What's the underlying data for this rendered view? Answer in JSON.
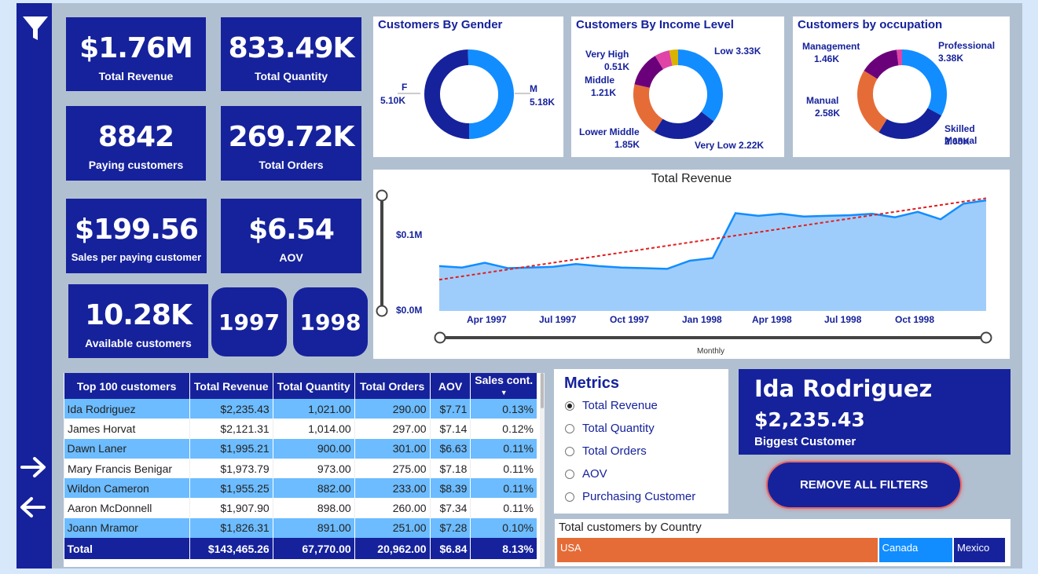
{
  "kpis": {
    "total_revenue": {
      "value": "$1.76M",
      "label": "Total Revenue"
    },
    "total_quantity": {
      "value": "833.49K",
      "label": "Total Quantity"
    },
    "paying_customers": {
      "value": "8842",
      "label": "Paying customers"
    },
    "total_orders": {
      "value": "269.72K",
      "label": "Total Orders"
    },
    "sales_per_paying": {
      "value": "$199.56",
      "label": "Sales per paying customer"
    },
    "aov": {
      "value": "$6.54",
      "label": "AOV"
    },
    "available_customers": {
      "value": "10.28K",
      "label": "Available customers"
    }
  },
  "years": [
    "1997",
    "1998"
  ],
  "gender_chart": {
    "title": "Customers By Gender",
    "labels": [
      {
        "name": "F",
        "value": "5.10K"
      },
      {
        "name": "M",
        "value": "5.18K"
      }
    ]
  },
  "income_chart": {
    "title": "Customers By Income Level",
    "labels": [
      {
        "name": "Low",
        "value": "3.33K"
      },
      {
        "name": "Very Low",
        "value": "2.22K"
      },
      {
        "name": "Lower Middle",
        "value": "1.85K"
      },
      {
        "name": "Middle",
        "value": "1.21K"
      },
      {
        "name": "Very High",
        "value": "0.51K"
      }
    ]
  },
  "occupation_chart": {
    "title": "Customers by occupation",
    "labels": [
      {
        "name": "Professional",
        "value": "3.38K"
      },
      {
        "name": "Skilled Manual",
        "value": "2.65K"
      },
      {
        "name": "Manual",
        "value": "2.58K"
      },
      {
        "name": "Management",
        "value": "1.46K"
      }
    ]
  },
  "revenue_chart": {
    "title": "Total Revenue",
    "xlabel": "Monthly",
    "y_ticks": [
      "$0.0M",
      "$0.1M"
    ],
    "x_ticks": [
      "Apr 1997",
      "Jul 1997",
      "Oct 1997",
      "Jan 1998",
      "Apr 1998",
      "Jul 1998",
      "Oct 1998"
    ]
  },
  "chart_data": [
    {
      "type": "pie",
      "title": "Customers By Gender",
      "categories": [
        "F",
        "M"
      ],
      "values": [
        5.1,
        5.18
      ],
      "unit": "K",
      "colors": [
        "#16229b",
        "#118dff"
      ]
    },
    {
      "type": "pie",
      "title": "Customers By Income Level",
      "categories": [
        "Low",
        "Very Low",
        "Lower Middle",
        "Middle",
        "Very High",
        "High"
      ],
      "values": [
        3.33,
        2.22,
        1.85,
        1.21,
        0.51,
        0.3
      ],
      "unit": "K",
      "colors": [
        "#118dff",
        "#16229b",
        "#e66c37",
        "#6b007b",
        "#e044a7",
        "#d9b300"
      ]
    },
    {
      "type": "pie",
      "title": "Customers by occupation",
      "categories": [
        "Professional",
        "Skilled Manual",
        "Manual",
        "Management",
        "Clerical"
      ],
      "values": [
        3.38,
        2.65,
        2.58,
        1.46,
        0.2
      ],
      "unit": "K",
      "colors": [
        "#118dff",
        "#16229b",
        "#e66c37",
        "#6b007b",
        "#e044a7"
      ]
    },
    {
      "type": "area",
      "title": "Total Revenue",
      "xlabel": "Monthly",
      "ylabel": "",
      "x": [
        "Jan 1997",
        "Feb 1997",
        "Mar 1997",
        "Apr 1997",
        "May 1997",
        "Jun 1997",
        "Jul 1997",
        "Aug 1997",
        "Sep 1997",
        "Oct 1997",
        "Nov 1997",
        "Dec 1997",
        "Jan 1998",
        "Feb 1998",
        "Mar 1998",
        "Apr 1998",
        "May 1998",
        "Jun 1998",
        "Jul 1998",
        "Aug 1998",
        "Sep 1998",
        "Oct 1998",
        "Nov 1998",
        "Dec 1998"
      ],
      "values": [
        0.066,
        0.064,
        0.071,
        0.063,
        0.064,
        0.065,
        0.069,
        0.066,
        0.064,
        0.063,
        0.062,
        0.074,
        0.078,
        0.144,
        0.14,
        0.143,
        0.139,
        0.14,
        0.141,
        0.143,
        0.138,
        0.146,
        0.135,
        0.158,
        0.163
      ],
      "trend": [
        0.046,
        0.166
      ],
      "ylim": [
        0,
        0.17
      ],
      "colors": {
        "area": "#9fcdfb",
        "line": "#118dff",
        "trend": "#e01e1e"
      }
    },
    {
      "type": "bar",
      "title": "Total customers by Country",
      "categories": [
        "USA",
        "Canada",
        "Mexico"
      ],
      "values": [
        7.95,
        1.85,
        1.3
      ],
      "colors": [
        "#e66c37",
        "#118dff",
        "#16229b"
      ]
    }
  ],
  "table": {
    "headers": [
      "Top 100 customers",
      "Total Revenue",
      "Total Quantity",
      "Total Orders",
      "AOV",
      "Sales cont."
    ],
    "rows": [
      [
        "Ida Rodriguez",
        "$2,235.43",
        "1,021.00",
        "290.00",
        "$7.71",
        "0.13%"
      ],
      [
        "James Horvat",
        "$2,121.31",
        "1,014.00",
        "297.00",
        "$7.14",
        "0.12%"
      ],
      [
        "Dawn Laner",
        "$1,995.21",
        "900.00",
        "301.00",
        "$6.63",
        "0.11%"
      ],
      [
        "Mary Francis Benigar",
        "$1,973.79",
        "973.00",
        "275.00",
        "$7.18",
        "0.11%"
      ],
      [
        "Wildon Cameron",
        "$1,955.25",
        "882.00",
        "233.00",
        "$8.39",
        "0.11%"
      ],
      [
        "Aaron McDonnell",
        "$1,907.90",
        "898.00",
        "260.00",
        "$7.34",
        "0.11%"
      ],
      [
        "Joann Mramor",
        "$1,826.31",
        "891.00",
        "251.00",
        "$7.28",
        "0.10%"
      ]
    ],
    "total": [
      "Total",
      "$143,465.26",
      "67,770.00",
      "20,962.00",
      "$6.84",
      "8.13%"
    ]
  },
  "metrics": {
    "title": "Metrics",
    "options": [
      "Total Revenue",
      "Total Quantity",
      "Total Orders",
      "AOV",
      "Purchasing Customer"
    ],
    "selected": "Total Revenue"
  },
  "biggest_customer": {
    "name": "Ida Rodriguez",
    "value": "$2,235.43",
    "label": "Biggest Customer"
  },
  "remove_filters_label": "REMOVE ALL FILTERS",
  "country_chart": {
    "title": "Total customers by Country",
    "labels": [
      "USA",
      "Canada",
      "Mexico"
    ]
  },
  "icons": {
    "filter": "funnel-icon",
    "next": "arrow-right-icon",
    "back": "arrow-left-icon"
  }
}
